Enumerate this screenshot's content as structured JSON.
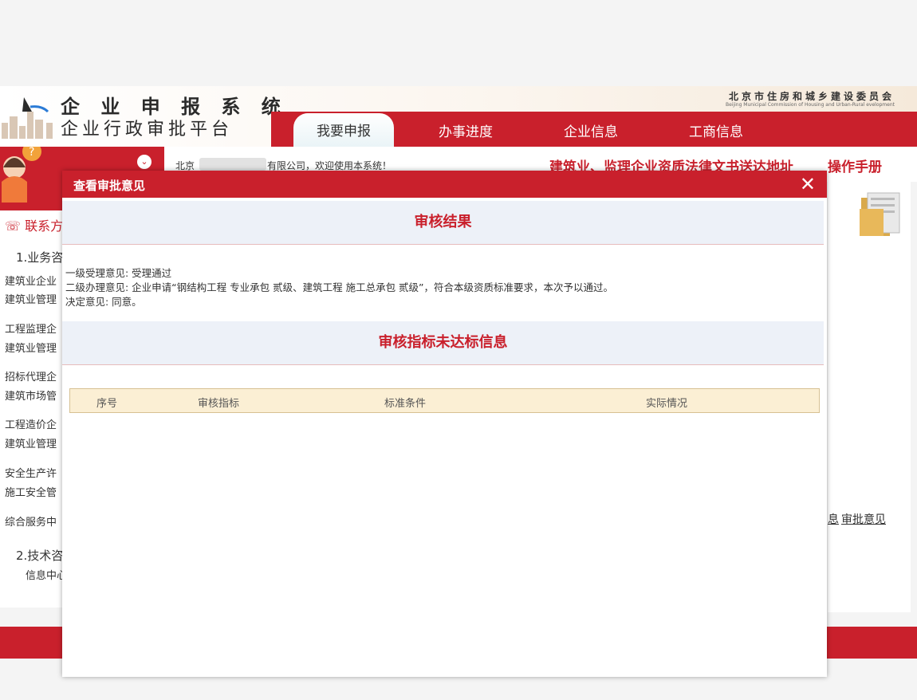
{
  "header": {
    "system_title": "企 业 申 报 系 统",
    "system_subtitle": "企业行政审批平台",
    "commission_cn": "北京市住房和城乡建设委员会",
    "commission_en": "Beijing Municipal Commission of Housing and Urban-Rural evelopment"
  },
  "nav": {
    "active": "我要申报",
    "items": [
      "办事进度",
      "企业信息",
      "工商信息"
    ]
  },
  "welcome": {
    "prefix": "北京",
    "suffix": "有限公司，欢迎使用本系统！",
    "notice_link": "建筑业、监理企业资质法律文书送达地址",
    "manual_link": "操作手册"
  },
  "left_panel": {
    "contact": "联系方",
    "lines": [
      "1.业务咨",
      "建筑业企业",
      "建筑业管理",
      "工程监理企",
      "建筑业管理",
      "招标代理企",
      "建筑市场管",
      "工程造价企",
      "建筑业管理",
      "安全生产许",
      "施工安全管",
      "综合服务中",
      "2.技术咨",
      "信息中心"
    ]
  },
  "right_panel": {
    "link_prev": "息",
    "link_opinion": "审批意见"
  },
  "dialog": {
    "title": "查看审批意见",
    "close": "✕",
    "section1": "审核结果",
    "opinions": [
      "一级受理意见: 受理通过",
      "二级办理意见: 企业申请“钢结构工程 专业承包 贰级、建筑工程 施工总承包 贰级”，符合本级资质标准要求，本次予以通过。",
      "决定意见: 同意。"
    ],
    "section2": "审核指标未达标信息",
    "table_headers": [
      "序号",
      "审核指标",
      "标准条件",
      "实际情况"
    ]
  }
}
